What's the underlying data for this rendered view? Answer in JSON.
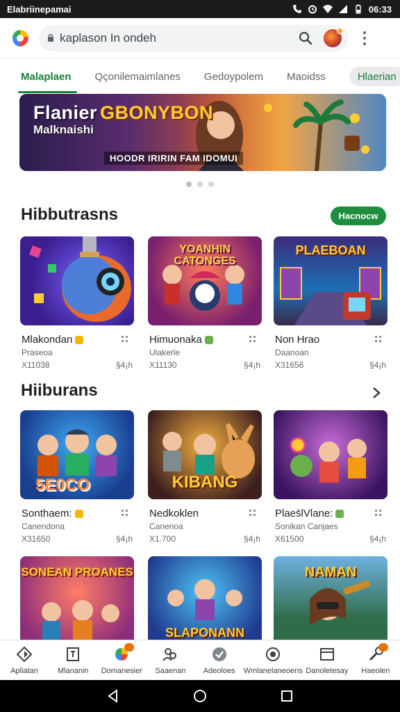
{
  "status_bar": {
    "title": "Elabriinepamai",
    "time": "06:33"
  },
  "search": {
    "value": "kaplason In ondeh"
  },
  "tabs": [
    {
      "label": "Malaplaen",
      "active": true
    },
    {
      "label": "Qçonilemaimlanes"
    },
    {
      "label": "Gedoypolem"
    },
    {
      "label": "Maoidss"
    },
    {
      "label": "Hlaerian",
      "pill": true
    }
  ],
  "banner": {
    "title_white": "Flanier",
    "title_gold": "GBONYBON",
    "subtitle": "Malknaishi",
    "tagline": "HOODR IRIRIN FAM IDOMUI"
  },
  "section1": {
    "title": "Hibbutrasns",
    "button": "Hacnocw"
  },
  "section2": {
    "title": "Hiiburans"
  },
  "row1": [
    {
      "name": "Mlakondan",
      "category": "Praseoa",
      "meta": "X11038",
      "rating": "§4¡h"
    },
    {
      "name": "Himuonaka",
      "category": "Ulakerle",
      "meta": "X11130",
      "rating": "§4¡h"
    },
    {
      "name": "Non Hrao",
      "category": "Daanoan",
      "meta": "X31656",
      "rating": "§4¡h"
    }
  ],
  "row2": [
    {
      "name": "Sonthaem:",
      "category": "Canendona",
      "meta": "X31650",
      "rating": "§4¡h",
      "thumb_text": "5E0CO"
    },
    {
      "name": "Nedkoklen",
      "category": "Canenoa",
      "meta": "X1.700",
      "rating": "§4¡h",
      "thumb_text": "KIBANG"
    },
    {
      "name": "Plaes̄lVlane:",
      "category": "Sonikan Canjaes",
      "meta": "X61500",
      "rating": "§4¡h"
    }
  ],
  "row3": [
    {
      "thumb_text": "SONEAN PROANES"
    },
    {
      "thumb_text": "SLAPONANN"
    },
    {
      "thumb_text": "NAMAN"
    }
  ],
  "row1_thumb_text": [
    "",
    "YOANHIN CATONGES",
    "PLAEBOAN"
  ],
  "bottom_nav": [
    {
      "label": "Apliatan",
      "icon": "apps-icon"
    },
    {
      "label": "Mlananin",
      "icon": "book-icon"
    },
    {
      "label": "Domanesier",
      "icon": "games-icon",
      "badge": ""
    },
    {
      "label": "Saaenan",
      "icon": "people-icon"
    },
    {
      "label": "Adeoloes",
      "icon": "check-circle-icon"
    },
    {
      "label": "Wmlanelaneoens",
      "icon": "smiley-icon"
    },
    {
      "label": "Danoletesay",
      "icon": "window-icon"
    },
    {
      "label": "Haeolen",
      "icon": "tools-icon",
      "badge": ""
    }
  ],
  "colors": {
    "accent": "#188038",
    "button": "#1e8e3e"
  }
}
